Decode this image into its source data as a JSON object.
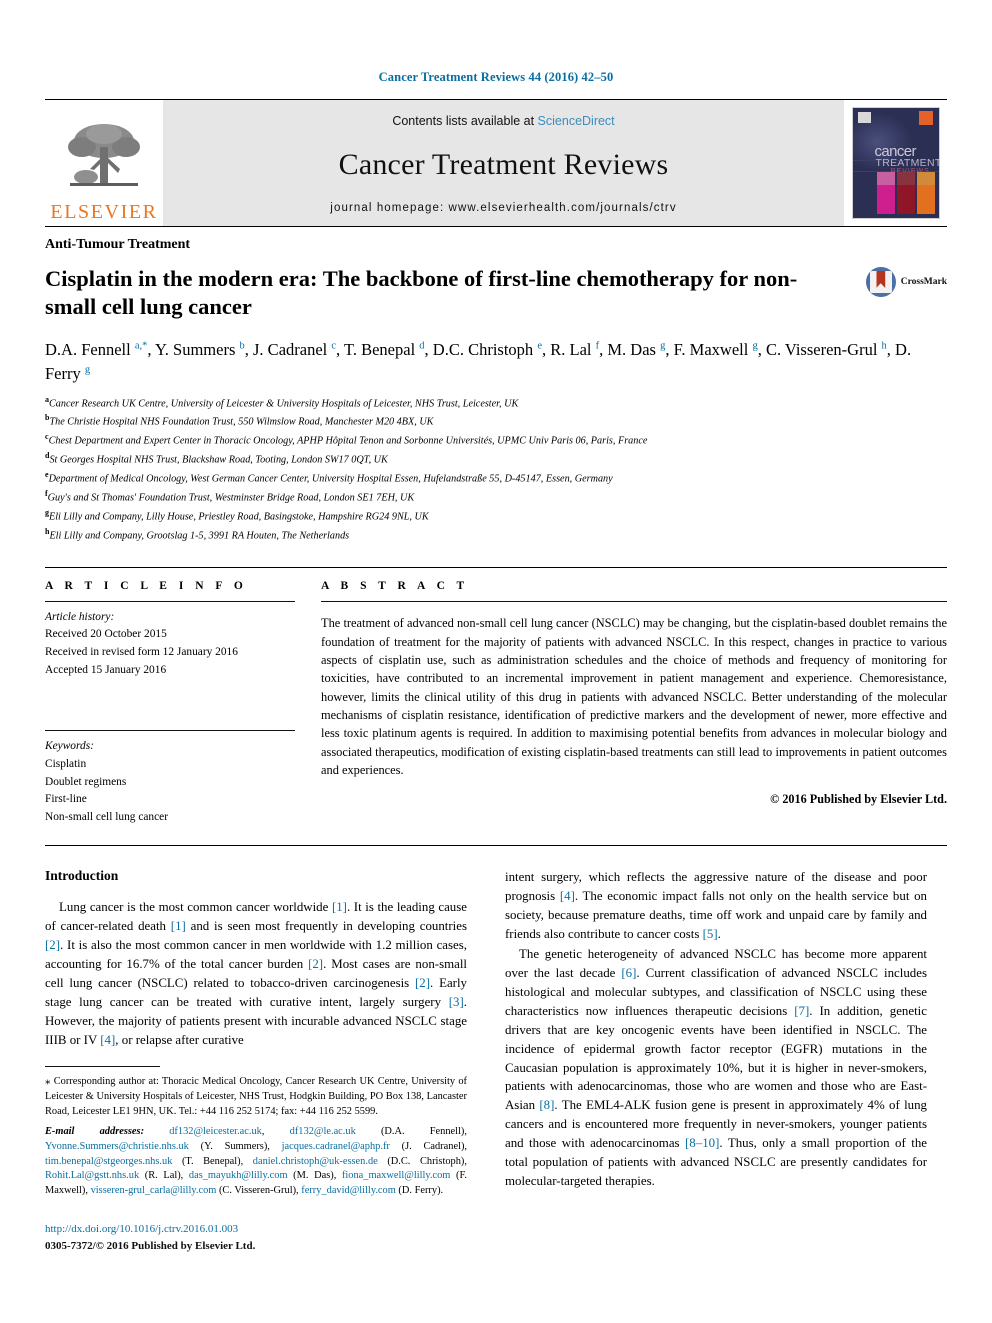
{
  "running_head": "Cancer Treatment Reviews 44 (2016) 42–50",
  "masthead": {
    "contents_prefix": "Contents lists available at ",
    "sciencedirect": "ScienceDirect",
    "journal_title": "Cancer Treatment Reviews",
    "homepage": "journal homepage: www.elsevierhealth.com/journals/ctrv",
    "publisher_wordmark": "ELSEVIER",
    "cover": {
      "line1": "cancer",
      "line2": "TREATMENT",
      "line3": "REVIEWS"
    }
  },
  "article": {
    "kicker": "Anti-Tumour Treatment",
    "title": "Cisplatin in the modern era: The backbone of first-line chemotherapy for non-small cell lung cancer",
    "crossmark_label": "CrossMark"
  },
  "authors_html": "D.A. Fennell <sup>a,*</sup>, Y. Summers <sup>b</sup>, J. Cadranel <sup>c</sup>, T. Benepal <sup>d</sup>, D.C. Christoph <sup>e</sup>, R. Lal <sup>f</sup>, M. Das <sup>g</sup>, F. Maxwell <sup>g</sup>, C. Visseren-Grul <sup>h</sup>, D. Ferry <sup>g</sup>",
  "affiliations": [
    {
      "label": "a",
      "text": "Cancer Research UK Centre, University of Leicester & University Hospitals of Leicester, NHS Trust, Leicester, UK"
    },
    {
      "label": "b",
      "text": "The Christie Hospital NHS Foundation Trust, 550 Wilmslow Road, Manchester M20 4BX, UK"
    },
    {
      "label": "c",
      "text": "Chest Department and Expert Center in Thoracic Oncology, APHP Hôpital Tenon and Sorbonne Universités, UPMC Univ Paris 06, Paris, France"
    },
    {
      "label": "d",
      "text": "St Georges Hospital NHS Trust, Blackshaw Road, Tooting, London SW17 0QT, UK"
    },
    {
      "label": "e",
      "text": "Department of Medical Oncology, West German Cancer Center, University Hospital Essen, Hufelandstraße 55, D-45147, Essen, Germany"
    },
    {
      "label": "f",
      "text": "Guy's and St Thomas' Foundation Trust, Westminster Bridge Road, London SE1 7EH, UK"
    },
    {
      "label": "g",
      "text": "Eli Lilly and Company, Lilly House, Priestley Road, Basingstoke, Hampshire RG24 9NL, UK"
    },
    {
      "label": "h",
      "text": "Eli Lilly and Company, Grootslag 1-5, 3991 RA Houten, The Netherlands"
    }
  ],
  "article_info": {
    "heading": "A R T I C L E  I N F O",
    "history_label": "Article history:",
    "history": [
      "Received 20 October 2015",
      "Received in revised form 12 January 2016",
      "Accepted 15 January 2016"
    ],
    "keywords_label": "Keywords:",
    "keywords": [
      "Cisplatin",
      "Doublet regimens",
      "First-line",
      "Non-small cell lung cancer"
    ]
  },
  "abstract": {
    "heading": "A B S T R A C T",
    "text": "The treatment of advanced non-small cell lung cancer (NSCLC) may be changing, but the cisplatin-based doublet remains the foundation of treatment for the majority of patients with advanced NSCLC. In this respect, changes in practice to various aspects of cisplatin use, such as administration schedules and the choice of methods and frequency of monitoring for toxicities, have contributed to an incremental improvement in patient management and experience. Chemoresistance, however, limits the clinical utility of this drug in patients with advanced NSCLC. Better understanding of the molecular mechanisms of cisplatin resistance, identification of predictive markers and the development of newer, more effective and less toxic platinum agents is required. In addition to maximising potential benefits from advances in molecular biology and associated therapeutics, modification of existing cisplatin-based treatments can still lead to improvements in patient outcomes and experiences.",
    "copyright": "© 2016 Published by Elsevier Ltd."
  },
  "introduction": {
    "heading": "Introduction",
    "left_p1_html": "Lung cancer is the most common cancer worldwide <span class=\"cite\">[1]</span>. It is the leading cause of cancer-related death <span class=\"cite\">[1]</span> and is seen most frequently in developing countries <span class=\"cite\">[2]</span>. It is also the most common cancer in men worldwide with 1.2 million cases, accounting for 16.7% of the total cancer burden <span class=\"cite\">[2]</span>. Most cases are non-small cell lung cancer (NSCLC) related to tobacco-driven carcinogenesis <span class=\"cite\">[2]</span>. Early stage lung cancer can be treated with curative intent, largely surgery <span class=\"cite\">[3]</span>. However, the majority of patients present with incurable advanced NSCLC stage IIIB or IV <span class=\"cite\">[4]</span>, or relapse after curative",
    "right_p1_html": "intent surgery, which reflects the aggressive nature of the disease and poor prognosis <span class=\"cite\">[4]</span>. The economic impact falls not only on the health service but on society, because premature deaths, time off work and unpaid care by family and friends also contribute to cancer costs <span class=\"cite\">[5]</span>.",
    "right_p2_html": "The genetic heterogeneity of advanced NSCLC has become more apparent over the last decade <span class=\"cite\">[6]</span>. Current classification of advanced NSCLC includes histological and molecular subtypes, and classification of NSCLC using these characteristics now influences therapeutic decisions <span class=\"cite\">[7]</span>. In addition, genetic drivers that are key oncogenic events have been identified in NSCLC. The incidence of epidermal growth factor receptor (EGFR) mutations in the Caucasian population is approximately 10%, but it is higher in never-smokers, patients with adenocarcinomas, those who are women and those who are East-Asian <span class=\"cite\">[8]</span>. The EML4-ALK fusion gene is present in approximately 4% of lung cancers and is encountered more frequently in never-smokers, younger patients and those with adenocarcinomas <span class=\"cite\">[8–10]</span>. Thus, only a small proportion of the total population of patients with advanced NSCLC are presently candidates for molecular-targeted therapies."
  },
  "footnote": {
    "correspondence_html": "<span class=\"star\">⁎</span> Corresponding author at: Thoracic Medical Oncology, Cancer Research UK Centre, University of Leicester &amp; University Hospitals of Leicester, NHS Trust, Hodgkin Building, PO Box 138, Lancaster Road, Leicester LE1 9HN, UK. Tel.: +44 116 252 5174; fax: +44 116 252 5599.",
    "emails_html": "<span class=\"it\">E-mail addresses:</span> <span class=\"lnk\">df132@leicester.ac.uk</span>, <span class=\"lnk\">df132@le.ac.uk</span> (D.A. Fennell), <span class=\"lnk\">Yvonne.Summers@christie.nhs.uk</span> (Y. Summers), <span class=\"lnk\">jacques.cadranel@aphp.fr</span> (J. Cadranel), <span class=\"lnk\">tim.benepal@stgeorges.nhs.uk</span> (T. Benepal), <span class=\"lnk\">daniel.christoph@uk-essen.de</span> (D.C. Christoph), <span class=\"lnk\">Rohit.Lal@gstt.nhs.uk</span> (R. Lal), <span class=\"lnk\">das_mayukh@lilly.com</span> (M. Das), <span class=\"lnk\">fiona_maxwell@lilly.com</span> (F. Maxwell), <span class=\"lnk\">visseren-grul_carla@lilly.com</span> (C. Visseren-Grul), <span class=\"lnk\">ferry_david@lilly.com</span> (D. Ferry)."
  },
  "doi_block": {
    "url": "http://dx.doi.org/10.1016/j.ctrv.2016.01.003",
    "issn_line": "0305-7372/© 2016 Published by Elsevier Ltd."
  },
  "colors": {
    "link_blue": "#0a6ea1",
    "elsevier_orange": "#e87722",
    "masthead_grey": "#e6e6e6",
    "cover_navy": "#2b2f54"
  }
}
